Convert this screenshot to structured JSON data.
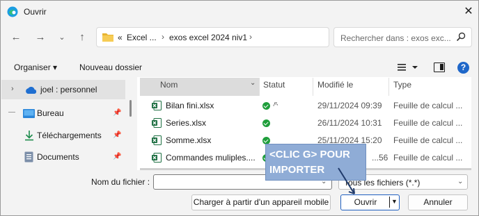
{
  "window": {
    "title": "Ouvrir"
  },
  "nav": {
    "address": {
      "breadcrumb": [
        "«",
        "Excel ...",
        "exos excel 2024 niv1"
      ]
    },
    "search": {
      "placeholder": "Rechercher dans : exos exc..."
    }
  },
  "toolbar": {
    "organize": "Organiser ▾",
    "new_folder": "Nouveau dossier"
  },
  "navpane": {
    "items": [
      {
        "label": "joel : personnel",
        "icon": "cloud-icon"
      },
      {
        "label": "Bureau",
        "icon": "desktop-icon"
      },
      {
        "label": "Téléchargements",
        "icon": "download-icon"
      },
      {
        "label": "Documents",
        "icon": "documents-icon"
      }
    ]
  },
  "filelist": {
    "columns": [
      "Nom",
      "Statut",
      "Modifié le",
      "Type"
    ],
    "rows": [
      {
        "name": "Bilan fini.xlsx",
        "modified": "29/11/2024 09:39",
        "type": "Feuille de calcul ..."
      },
      {
        "name": "Series.xlsx",
        "modified": "26/11/2024 10:31",
        "type": "Feuille de calcul ..."
      },
      {
        "name": "Somme.xlsx",
        "modified": "25/11/2024 15:20",
        "type": "Feuille de calcul ..."
      },
      {
        "name": "Commandes muliples....",
        "modified": "...56",
        "type": "Feuille de calcul ..."
      }
    ]
  },
  "bottom": {
    "filename_label": "Nom du fichier :",
    "filename_value": "",
    "filter": "Tous les fichiers (*.*)",
    "device_button": "Charger à partir d'un appareil mobile",
    "open_button": "Ouvrir",
    "cancel_button": "Annuler"
  },
  "annotation": {
    "text": "<CLIC G> POUR IMPORTER"
  },
  "colors": {
    "accent": "#1f5fbf",
    "callout": "#8facd6",
    "excel": "#1d6f42",
    "ok": "#1f9e3b"
  }
}
